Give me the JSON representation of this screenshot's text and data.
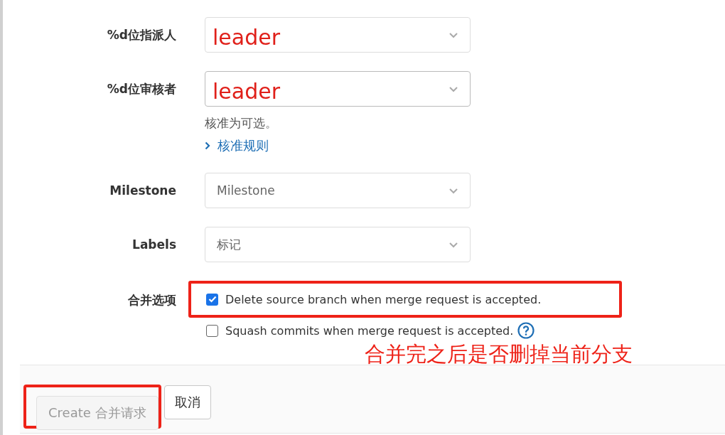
{
  "fields": [
    {
      "label": "%d位指派人",
      "value": "leader",
      "handwritten": true
    },
    {
      "label": "%d位审核者",
      "value": "leader",
      "handwritten": true,
      "help": "核准为可选。",
      "link": "核准规则"
    },
    {
      "label": "Milestone",
      "placeholder": "Milestone"
    },
    {
      "label": "Labels",
      "placeholder": "标记"
    }
  ],
  "merge_options": {
    "label": "合并选项",
    "options": [
      {
        "text": "Delete source branch when merge request is accepted.",
        "checked": true,
        "highlighted": true
      },
      {
        "text": "Squash commits when merge request is accepted.",
        "checked": false,
        "highlighted": false,
        "help_icon": true
      }
    ]
  },
  "annotation": "合并完之后是否删掉当前分支",
  "buttons": [
    {
      "label": "Create 合并请求",
      "kind": "primary",
      "disabled": true,
      "highlighted": true
    },
    {
      "label": "取消",
      "kind": "cancel",
      "disabled": false,
      "highlighted": false
    }
  ]
}
